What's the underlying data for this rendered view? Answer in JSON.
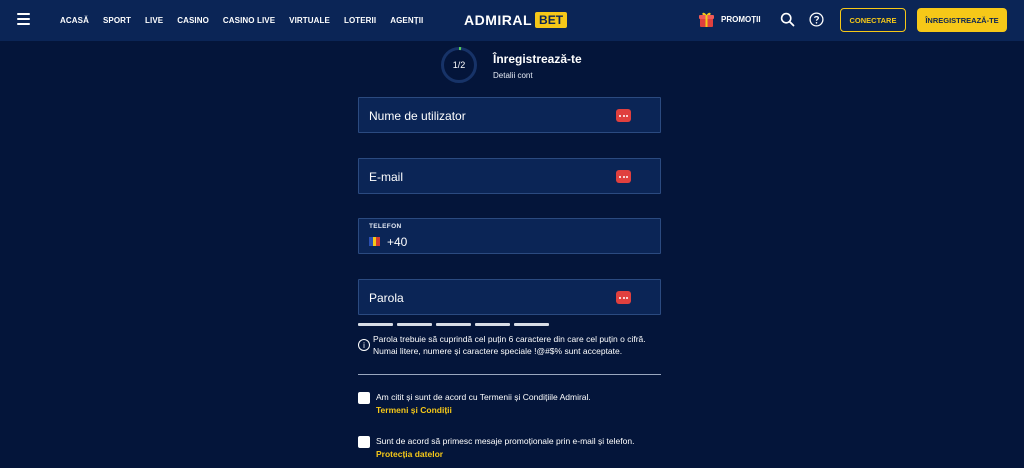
{
  "header": {
    "nav": [
      "ACASĂ",
      "SPORT",
      "LIVE",
      "CASINO",
      "CASINO LIVE",
      "VIRTUALE",
      "LOTERII",
      "AGENȚII"
    ],
    "logo_text": "ADMIRAL",
    "logo_badge": "BET",
    "promo_label": "PROMOȚII",
    "login_label": "CONECTARE",
    "register_label": "ÎNREGISTREAZĂ-TE"
  },
  "step": {
    "count": "1/2",
    "progress": 0.5,
    "title": "Înregistrează-te",
    "subtitle": "Detalii cont"
  },
  "form": {
    "username_label": "Nume de utilizator",
    "email_label": "E-mail",
    "phone_label": "TELEFON",
    "phone_prefix": "+40",
    "password_label": "Parola",
    "password_hint_line1": "Parola trebuie să cuprindă cel puțin 6 caractere din care cel puțin o cifră.",
    "password_hint_line2": "Numai litere, numere și caractere speciale !@#$% sunt acceptate.",
    "terms_text": "Am citit și sunt de acord cu Termenii și Condițiile Admiral.",
    "terms_link": "Termeni și Condiții",
    "marketing_text": "Sunt de acord să primesc mesaje promoționale prin e-mail și telefon.",
    "marketing_link": "Protecția datelor"
  },
  "colors": {
    "background": "#04153a",
    "header": "#0b2556",
    "accent": "#f6c818",
    "field_warning": "#e0403e"
  },
  "icons": {
    "menu": "hamburger-icon",
    "promo": "gift-icon",
    "search": "search-icon",
    "help": "help-icon",
    "field_status": "dots-icon",
    "phone_country": "romania-flag-icon",
    "hint": "info-icon"
  }
}
